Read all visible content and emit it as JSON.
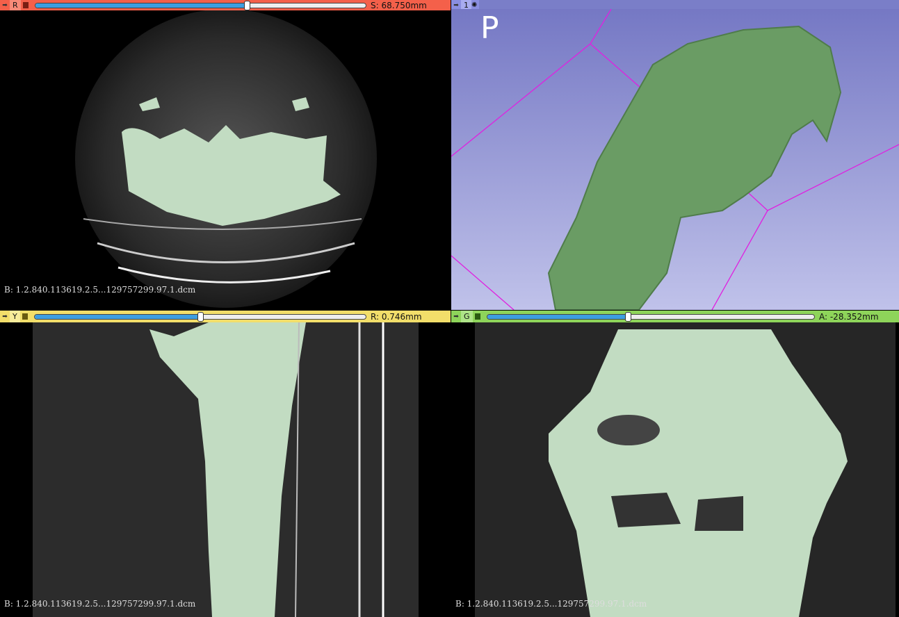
{
  "views": {
    "red": {
      "label": "R",
      "value": "S: 68.750mm",
      "slider_pct": 64,
      "color": "#f4604a",
      "corner": "B: 1.2.840.113619.2.5...129757299.97.1.dcm"
    },
    "threed": {
      "label": "1",
      "orientation": "P",
      "color": "#8a8ee0"
    },
    "yellow": {
      "label": "Y",
      "value": "R: 0.746mm",
      "slider_pct": 50,
      "color": "#f2de6a",
      "corner": "B: 1.2.840.113619.2.5...129757299.97.1.dcm"
    },
    "green": {
      "label": "G",
      "value": "A: -28.352mm",
      "slider_pct": 43,
      "color": "#8ed45a",
      "corner": "B: 1.2.840.113619.2.5...129757299.97.1.dcm"
    }
  },
  "icons": {
    "pin": "pin-icon",
    "link": "link-icon",
    "gear": "gear-icon"
  }
}
